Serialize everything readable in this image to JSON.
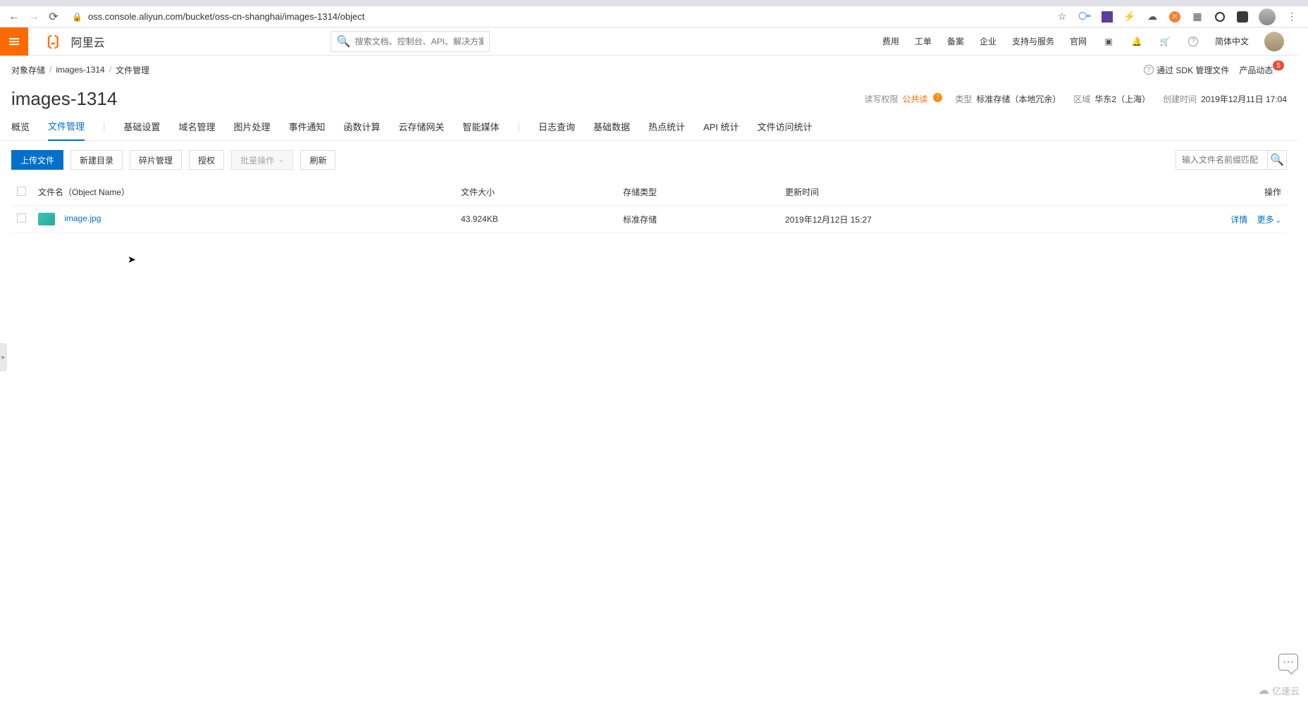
{
  "browser": {
    "url": "oss.console.aliyun.com/bucket/oss-cn-shanghai/images-1314/object"
  },
  "header": {
    "logo_text": "阿里云",
    "search_placeholder": "搜索文档、控制台、API、解决方案和资源",
    "links": {
      "billing": "费用",
      "ticket": "工单",
      "beian": "备案",
      "enterprise": "企业",
      "support": "支持与服务",
      "official": "官网",
      "language": "简体中文"
    }
  },
  "breadcrumb": {
    "item0": "对象存储",
    "item1": "images-1314",
    "item2": "文件管理",
    "right": {
      "sdk": "通过 SDK 管理文件",
      "news": "产品动态",
      "news_badge": "5"
    }
  },
  "page": {
    "title": "images-1314",
    "meta": {
      "rw_label": "读写权限",
      "rw_value": "公共读",
      "type_label": "类型",
      "type_value": "标准存储（本地冗余）",
      "region_label": "区域",
      "region_value": "华东2（上海）",
      "created_label": "创建时间",
      "created_value": "2019年12月11日 17:04"
    }
  },
  "tabs": {
    "overview": "概览",
    "files": "文件管理",
    "basic": "基础设置",
    "domain": "域名管理",
    "image": "图片处理",
    "event": "事件通知",
    "function": "函数计算",
    "gateway": "云存储网关",
    "media": "智能媒体",
    "log": "日志查询",
    "basicdata": "基础数据",
    "hotspot": "热点统计",
    "api": "API 统计",
    "access": "文件访问统计"
  },
  "toolbar": {
    "upload": "上传文件",
    "newdir": "新建目录",
    "fragment": "碎片管理",
    "auth": "授权",
    "batch": "批量操作",
    "refresh": "刷新",
    "search_placeholder": "输入文件名前缀匹配"
  },
  "table": {
    "headers": {
      "name": "文件名（Object Name）",
      "size": "文件大小",
      "storage": "存储类型",
      "updated": "更新时间",
      "action": "操作"
    },
    "rows": [
      {
        "name": "image.jpg",
        "size": "43.924KB",
        "storage": "标准存储",
        "updated": "2019年12月12日 15:27",
        "detail": "详情",
        "more": "更多"
      }
    ]
  },
  "watermark": "亿速云"
}
